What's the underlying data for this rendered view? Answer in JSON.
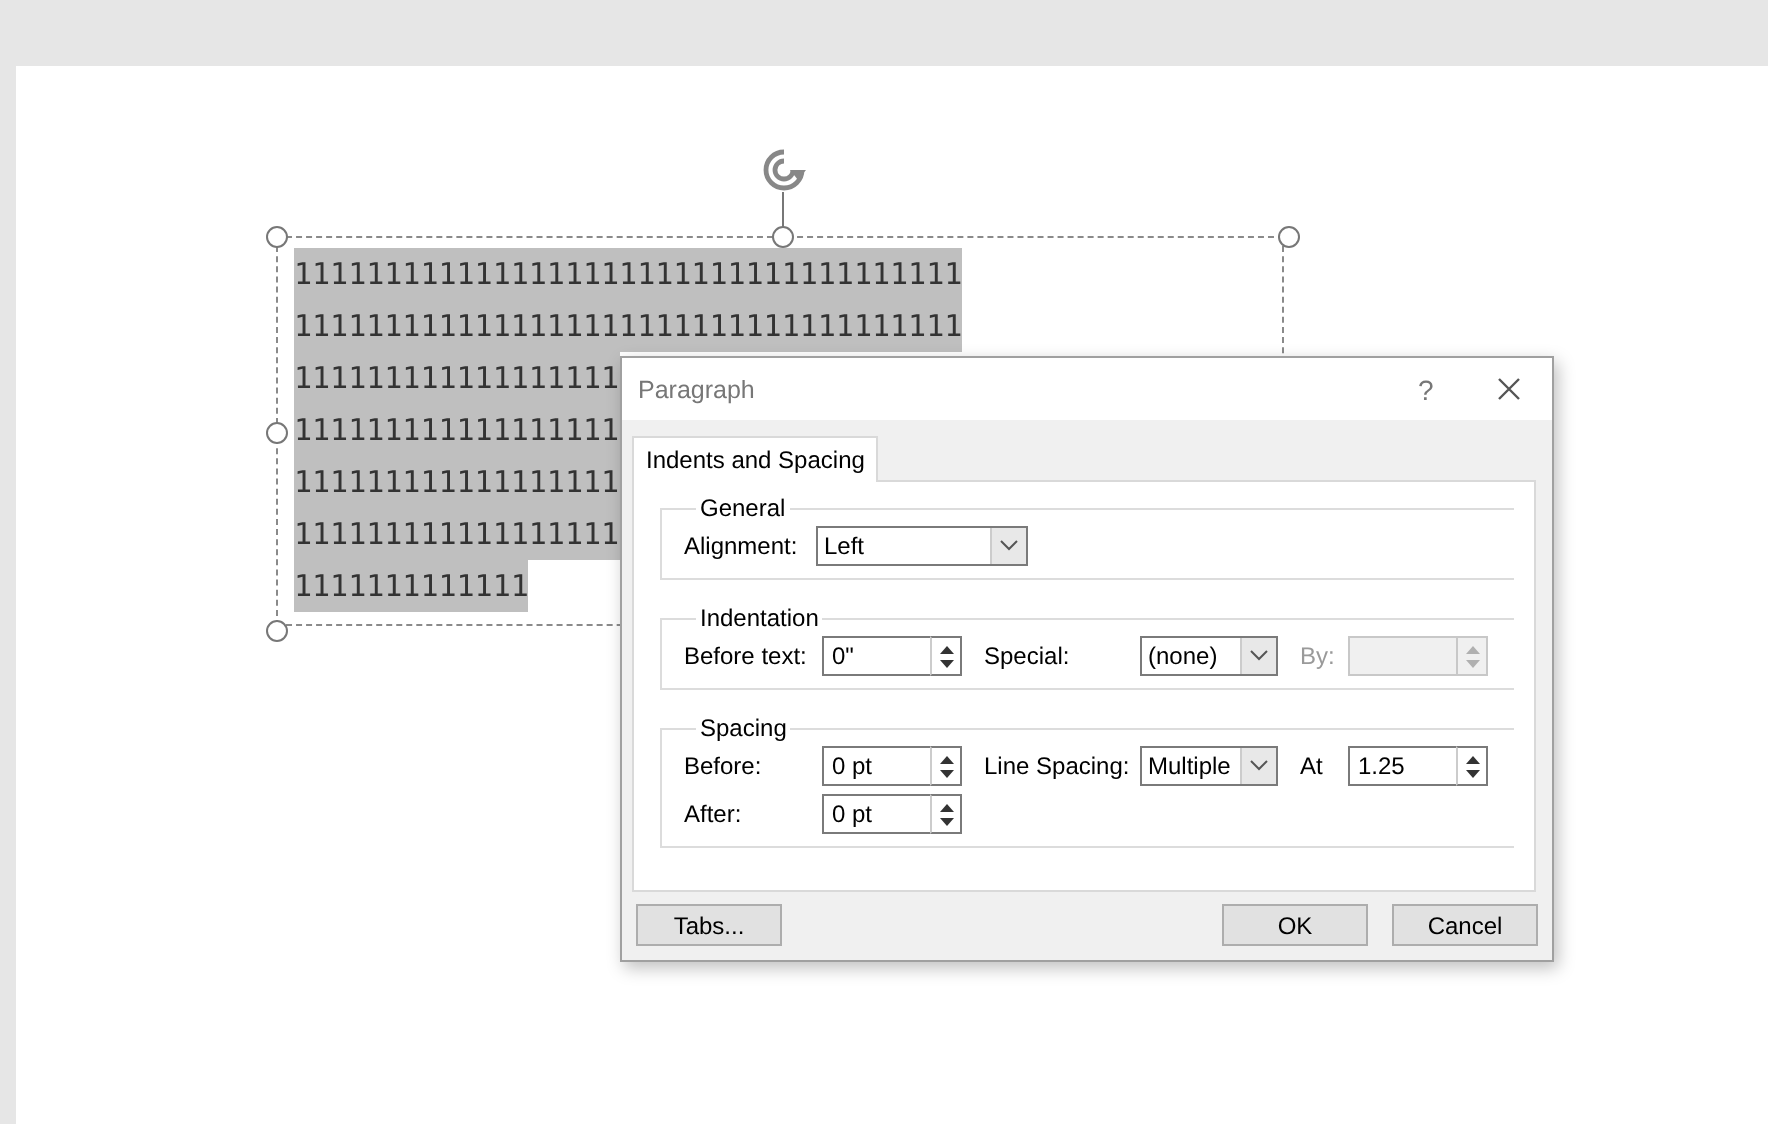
{
  "slide": {
    "text_box": {
      "selected": true,
      "lines": [
        "1111111111111111111111111111111111111",
        "1111111111111111111111111111111111111",
        "111111111111111111",
        "111111111111111111",
        "111111111111111111",
        "111111111111111111",
        "1111111111111"
      ]
    }
  },
  "dialog": {
    "title": "Paragraph",
    "help": "?",
    "tabs": [
      {
        "label": "Indents and Spacing",
        "selected": true
      }
    ],
    "sections": [
      {
        "title": "General",
        "rows": [
          {
            "fields": [
              {
                "kind": "dropdown",
                "label": "Alignment:",
                "value": "Left",
                "disabled": false
              }
            ]
          }
        ]
      },
      {
        "title": "Indentation",
        "rows": [
          {
            "fields": [
              {
                "kind": "spinner",
                "label": "Before text:",
                "value": "0\"",
                "disabled": false
              },
              {
                "kind": "dropdown",
                "label": "Special:",
                "value": "(none)",
                "disabled": false
              },
              {
                "kind": "spinner",
                "label": "By:",
                "disabled": true
              }
            ]
          }
        ]
      },
      {
        "title": "Spacing",
        "rows": [
          {
            "fields": [
              {
                "kind": "spinner",
                "label": "Before:",
                "value": "0 pt",
                "disabled": false
              },
              {
                "kind": "dropdown",
                "label": "Line Spacing:",
                "value": "Multiple",
                "disabled": false
              },
              {
                "kind": "spinner",
                "label": "At",
                "value": "1.25",
                "disabled": false
              }
            ]
          },
          {
            "fields": [
              {
                "kind": "spinner",
                "label": "After:",
                "value": "0 pt",
                "disabled": false
              }
            ]
          }
        ]
      }
    ],
    "buttons": [
      {
        "label": "Tabs...",
        "kind": "left"
      },
      {
        "label": "OK",
        "kind": "right"
      },
      {
        "label": "Cancel",
        "kind": "right"
      }
    ]
  }
}
